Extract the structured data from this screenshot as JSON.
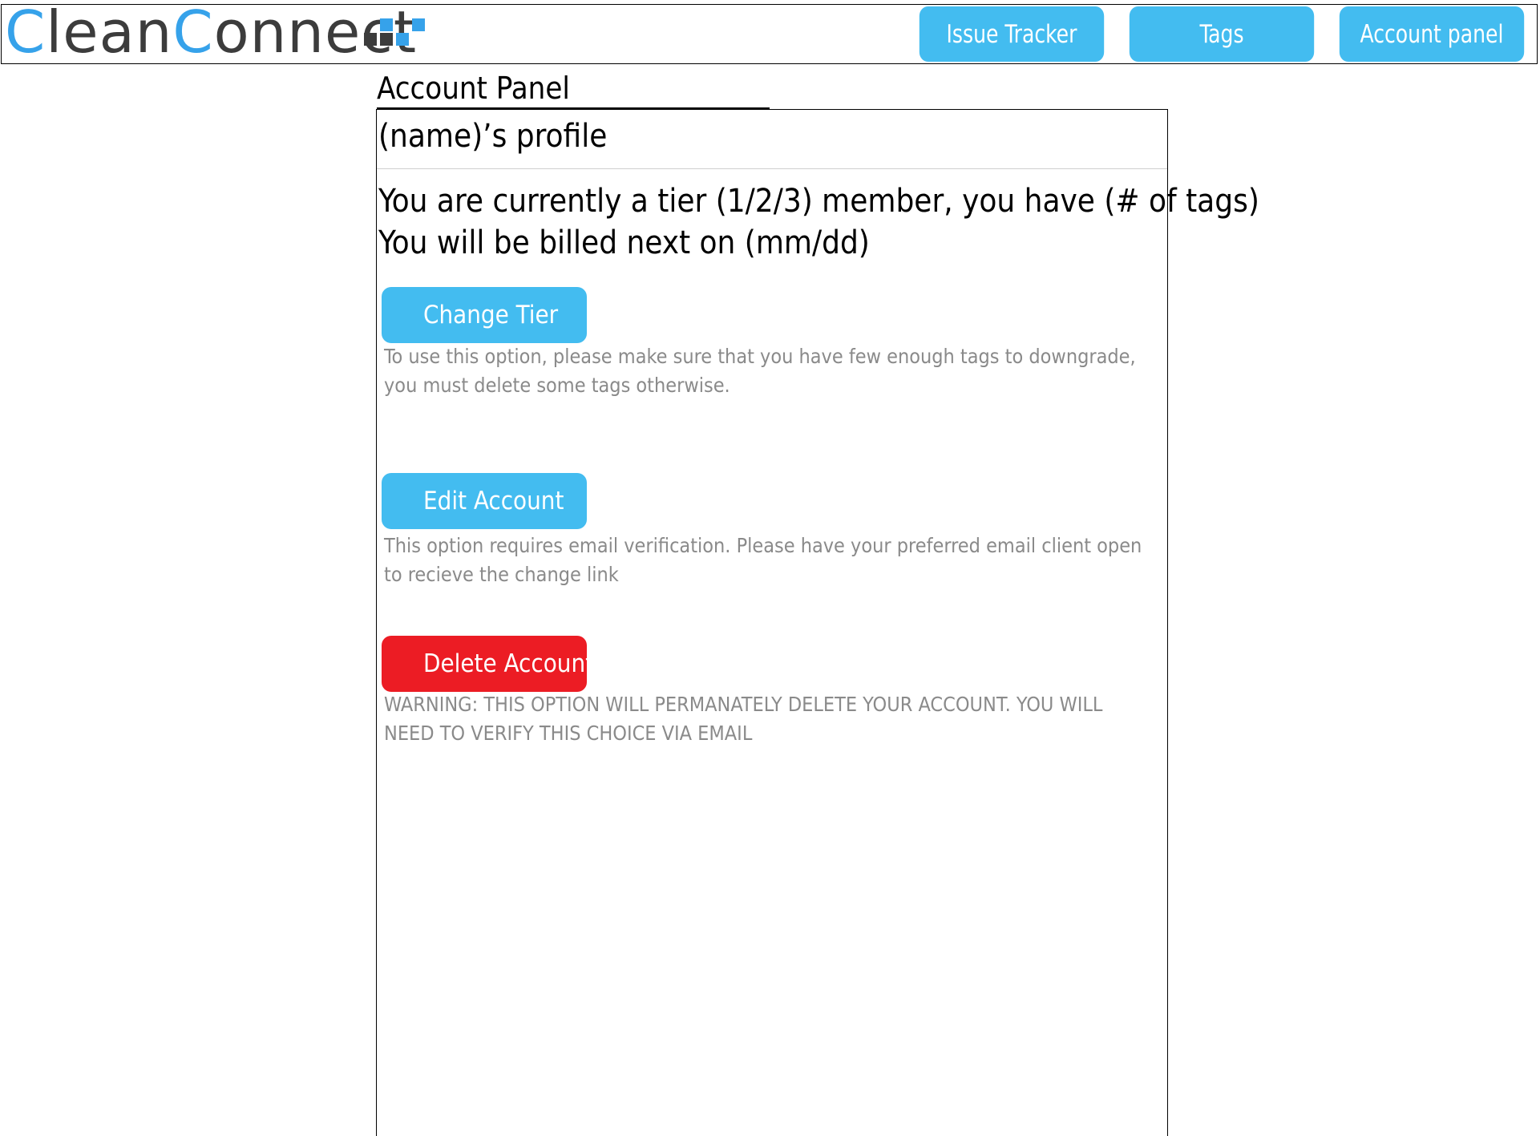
{
  "header": {
    "logo": {
      "part1_accent": "C",
      "part1_rest": "lean",
      "part2_accent": "C",
      "part2_rest": "onnect"
    },
    "nav": [
      {
        "label": "Issue Tracker"
      },
      {
        "label": "Tags"
      },
      {
        "label": "Account panel"
      }
    ]
  },
  "page": {
    "title": "Account Panel"
  },
  "profile": {
    "title": "(name)’s profile",
    "summary_line1": "You are currently a tier (1/2/3) member, you have (# of tags)",
    "summary_line2": "You will be billed next on (mm/dd)"
  },
  "actions": [
    {
      "label": "Change Tier",
      "description": "To use this option, please make sure that you have few enough tags to downgrade, you must delete some tags otherwise."
    },
    {
      "label": "Edit Account",
      "description": "This option requires email verification. Please have your preferred email client open to recieve the change link"
    },
    {
      "label": "Delete Account",
      "description": "WARNING: THIS OPTION WILL PERMANATELY DELETE YOUR ACCOUNT. YOU WILL NEED TO VERIFY THIS CHOICE VIA EMAIL"
    }
  ],
  "colors": {
    "brand_blue": "#43bcf0",
    "logo_blue": "#36a2ea",
    "danger_red": "#ec1c24",
    "muted_text": "#8a8a8a"
  }
}
